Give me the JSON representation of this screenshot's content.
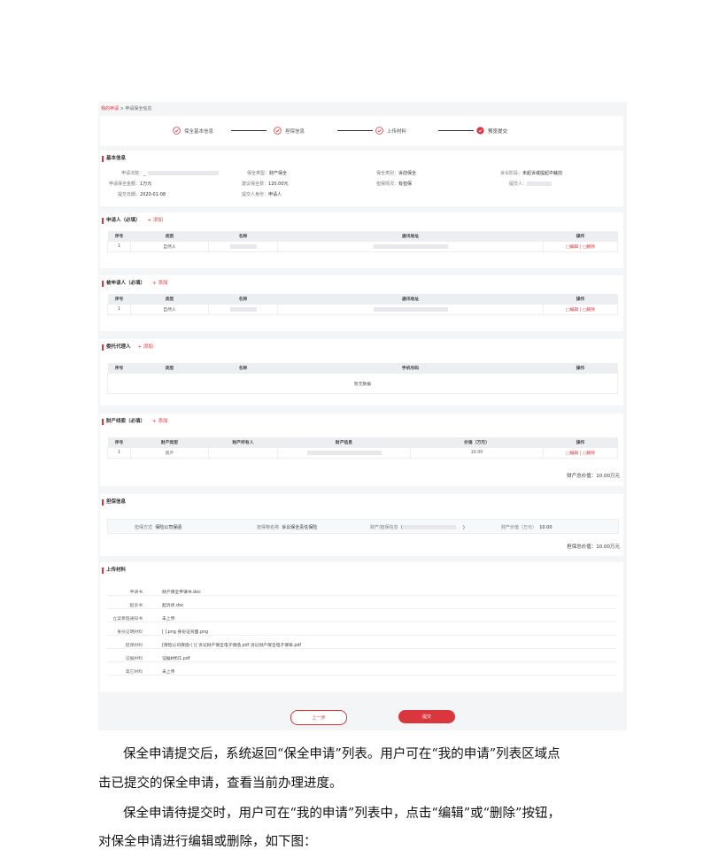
{
  "breadcrumb": {
    "link": "我的申请",
    "sep": " > ",
    "current": "申请保全信息"
  },
  "steps": [
    "保全基本信息",
    "担保信息",
    "上传材料",
    "预览提交"
  ],
  "basic": {
    "title": "基本信息",
    "court_label": "申请法院：",
    "court_value": "_",
    "type_label": "保全类型：",
    "type_value": "财产保全",
    "category_label": "保全类别：",
    "category_value": "诉前保全",
    "stage_label": "诉讼阶段：",
    "stage_value": "未起诉或提起中裁前",
    "amount_label": "申请保全金额：",
    "amount_value": "1万元",
    "suggest_label": "建议保全费：",
    "suggest_value": "120.00元",
    "guarantee_label": "担保情况：",
    "guarantee_value": "有担保",
    "submitter_label": "提交人：",
    "date_label": "提交日期：",
    "date_value": "2020-01-08",
    "identity_label": "提交人身份：",
    "identity_value": "申请人"
  },
  "applicant": {
    "title": "申请人（必填）",
    "add": "+ 添加",
    "headers": [
      "序号",
      "类型",
      "名称",
      "通讯地址",
      "操作"
    ],
    "row": {
      "no": "1",
      "type": "自然人"
    },
    "ops": "□编辑 | □删除"
  },
  "respondent": {
    "title": "被申请人（必填）",
    "add": "+ 添加",
    "headers": [
      "序号",
      "类型",
      "名称",
      "通讯地址",
      "操作"
    ],
    "row": {
      "no": "1",
      "type": "自然人"
    },
    "ops": "□编辑 | □删除"
  },
  "agent": {
    "title": "委托代理人",
    "add": "+ 添加",
    "headers": [
      "序号",
      "类型",
      "名称",
      "手机号码",
      "操作"
    ],
    "empty": "暂无数据"
  },
  "property": {
    "title": "财产线索（必填）",
    "add": "+ 添加",
    "headers": [
      "序号",
      "财产类型",
      "财产所有人",
      "财产信息",
      "价值（万元）",
      "操作"
    ],
    "row": {
      "no": "1",
      "type": "房产",
      "value": "10.00"
    },
    "ops": "□编辑 | □删除",
    "total": "财产总价值：10.00万元"
  },
  "guarantee": {
    "title": "担保信息",
    "method_label": "担保方式",
    "method_value": "保险公司保函",
    "item_label": "担保物名称",
    "item_value": "诉讼保全责任保险",
    "prop_label": "财产/担保信息",
    "prop_value": "(",
    "prop_value_end": ")",
    "value_label": "财产价值（万元）",
    "value_value": "10.00",
    "total": "担保总价值：10.00万元"
  },
  "materials": {
    "title": "上传材料",
    "rows": [
      {
        "k": "申请书",
        "v": "财产保全申请书.doc"
      },
      {
        "k": "起诉书",
        "v": "起诉状.doc"
      },
      {
        "k": "立案受理通知书",
        "v": "未上传"
      },
      {
        "k": "身份证明材料",
        "v": "[                              ].png  身份证背面.png"
      },
      {
        "k": "担保材料",
        "v": "[保险公司保函-(                              )]  诉讼财产保全电子保函.pdf  诉讼财产保全电子保单.pdf"
      },
      {
        "k": "证据材料",
        "v": "证据材料1.pdf"
      },
      {
        "k": "其它材料",
        "v": "未上传"
      }
    ]
  },
  "buttons": {
    "prev": "上一步",
    "submit": "提交"
  },
  "paragraphs": [
    "保全申请提交后，系统返回“保全申请”列表。用户可在“我的申请”列表区域点",
    "击已提交的保全申请，查看当前办理进度。",
    "保全申请待提交时，用户可在“我的申请”列表中，点击“编辑”或“删除”按钮，",
    "对保全申请进行编辑或删除，如下图："
  ],
  "colors": {
    "accent": "#d9363e"
  }
}
